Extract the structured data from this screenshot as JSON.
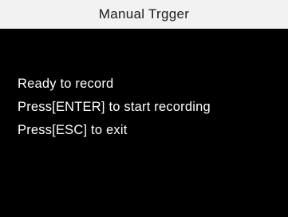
{
  "window": {
    "title": "Manual Trgger"
  },
  "colors": {
    "title_bar_bg": "#f2f2f2",
    "screen_bg": "#000000",
    "text": "#ffffff"
  },
  "messages": {
    "status": "Ready to record",
    "enter_hint": "Press[ENTER] to start recording",
    "esc_hint": "Press[ESC] to exit"
  }
}
